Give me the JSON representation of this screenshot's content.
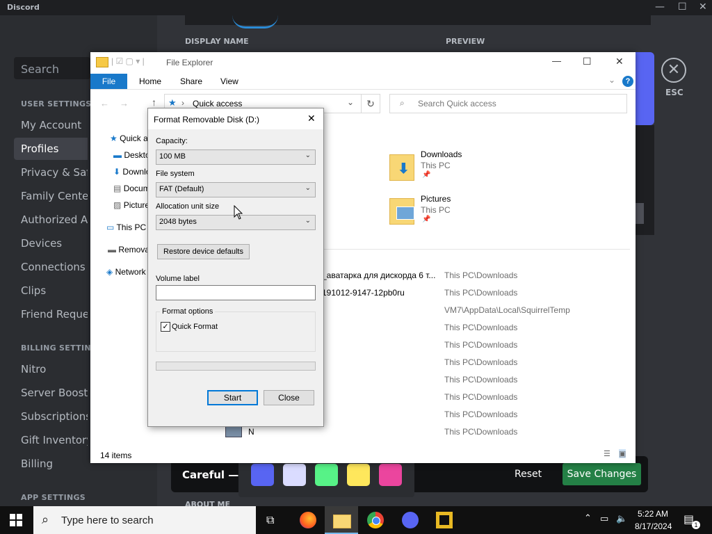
{
  "discord": {
    "app_name": "Discord",
    "window_controls": {
      "minimize": "—",
      "maximize": "☐",
      "close": "✕"
    },
    "search_placeholder": "Search",
    "sections": {
      "user_settings": "USER SETTINGS",
      "billing_settings": "BILLING SETTINGS",
      "app_settings": "APP SETTINGS"
    },
    "user_items": [
      "My Account",
      "Profiles",
      "Privacy & Safety",
      "Family Center",
      "Authorized Apps",
      "Devices",
      "Connections",
      "Clips",
      "Friend Requests"
    ],
    "billing_items": [
      "Nitro",
      "Server Boost",
      "Subscriptions",
      "Gift Inventory",
      "Billing"
    ],
    "selected_item": "Profiles",
    "display_name_header": "DISPLAY NAME",
    "preview_header": "PREVIEW",
    "about_me_header": "ABOUT ME",
    "esc_label": "ESC",
    "unsaved_text": "Careful — you have unsaved changes!",
    "reset_label": "Reset",
    "save_label": "Save Changes",
    "swatch_colors": [
      "#5865f2",
      "#dadcff",
      "#57f287",
      "#fee75c",
      "#eb459e"
    ],
    "accent_color": "#5865f2",
    "save_color": "#248046"
  },
  "explorer": {
    "title": "File Explorer",
    "window_controls": {
      "minimize": "—",
      "maximize": "☐",
      "close": "✕"
    },
    "ribbon_tabs": [
      "File",
      "Home",
      "Share",
      "View"
    ],
    "address": "Quick access",
    "search_placeholder": "Search Quick access",
    "nav_items": [
      "Quick access",
      "Desktop",
      "Downloads",
      "Documents",
      "Pictures",
      "This PC",
      "Removable Disk (D:)",
      "Network"
    ],
    "folders": [
      {
        "name": "Downloads",
        "location": "This PC"
      },
      {
        "name": "Pictures",
        "location": "This PC"
      }
    ],
    "recent_files": [
      {
        "name": "_аватарка для дискорда 6 т...",
        "path": "This PC\\Downloads"
      },
      {
        "name": "191012-9147-12pb0ru",
        "path": "This PC\\Downloads"
      },
      {
        "name": "",
        "path": "VM7\\AppData\\Local\\SquirrelTemp"
      },
      {
        "name": "",
        "path": "This PC\\Downloads"
      },
      {
        "name": "",
        "path": "This PC\\Downloads"
      },
      {
        "name": "",
        "path": "This PC\\Downloads"
      },
      {
        "name": "",
        "path": "This PC\\Downloads"
      },
      {
        "name": "",
        "path": "This PC\\Downloads"
      },
      {
        "name": "",
        "path": "This PC\\Downloads"
      },
      {
        "name": "N",
        "path": "This PC\\Downloads"
      }
    ],
    "status": "14 items",
    "file_tab_color": "#1979ca"
  },
  "format_dialog": {
    "title": "Format Removable Disk (D:)",
    "capacity_label": "Capacity:",
    "capacity_value": "100 MB",
    "filesystem_label": "File system",
    "filesystem_value": "FAT (Default)",
    "allocation_label": "Allocation unit size",
    "allocation_value": "2048 bytes",
    "restore_label": "Restore device defaults",
    "volume_label": "Volume label",
    "volume_value": "",
    "format_options_label": "Format options",
    "quick_format_label": "Quick Format",
    "quick_format_checked": true,
    "progress": 0,
    "start_label": "Start",
    "close_label": "Close"
  },
  "taskbar": {
    "search_placeholder": "Type here to search",
    "apps": [
      "task-view",
      "firefox",
      "file-explorer",
      "chrome",
      "discord",
      "app"
    ],
    "time": "5:22 AM",
    "date": "8/17/2024",
    "notification_count": "1"
  }
}
